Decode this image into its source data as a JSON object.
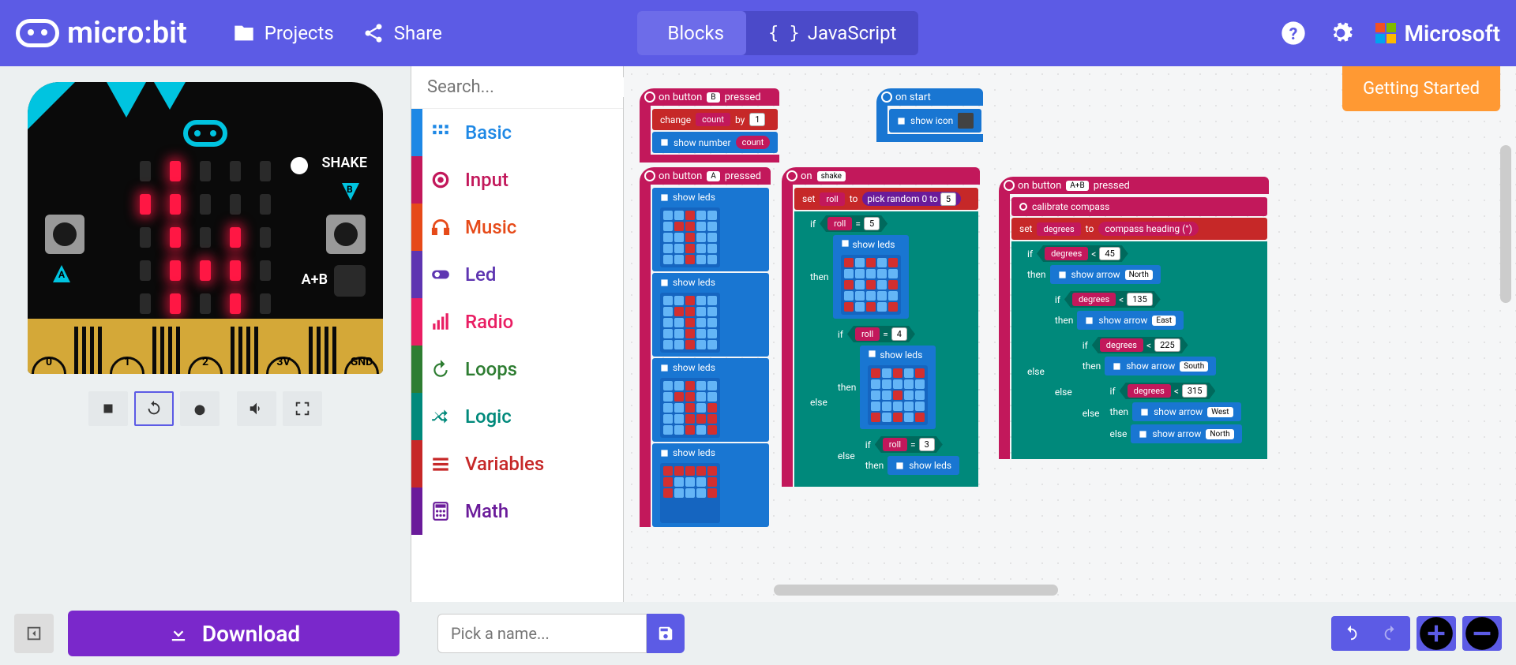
{
  "header": {
    "logo_text": "micro:bit",
    "projects": "Projects",
    "share": "Share",
    "tabs": {
      "blocks": "Blocks",
      "javascript": "JavaScript"
    },
    "microsoft": "Microsoft"
  },
  "simulator": {
    "shake": "SHAKE",
    "ab_label": "A+B",
    "pins": [
      "0",
      "1",
      "2",
      "3V",
      "GND"
    ]
  },
  "search": {
    "placeholder": "Search..."
  },
  "categories": [
    {
      "name": "Basic",
      "color": "#1e88e5",
      "icon": "grid"
    },
    {
      "name": "Input",
      "color": "#c2185b",
      "icon": "target"
    },
    {
      "name": "Music",
      "color": "#e64a19",
      "icon": "headphones"
    },
    {
      "name": "Led",
      "color": "#5e35b1",
      "icon": "toggle"
    },
    {
      "name": "Radio",
      "color": "#e91e63",
      "icon": "bars"
    },
    {
      "name": "Loops",
      "color": "#2e7d32",
      "icon": "redo"
    },
    {
      "name": "Logic",
      "color": "#00897b",
      "icon": "shuffle"
    },
    {
      "name": "Variables",
      "color": "#c62828",
      "icon": "menu"
    },
    {
      "name": "Math",
      "color": "#6a1b9a",
      "icon": "calc"
    }
  ],
  "workspace": {
    "getting_started": "Getting Started",
    "blocks": {
      "onB": {
        "header": "on button",
        "btn": "B",
        "suffix": "pressed",
        "change": "change",
        "var": "count",
        "by": "by",
        "val": "1",
        "shownum": "show number",
        "showvar": "count"
      },
      "onStart": {
        "header": "on start",
        "showicon": "show icon"
      },
      "onA": {
        "header": "on button",
        "btn": "A",
        "suffix": "pressed",
        "showleds": "show leds"
      },
      "onShake": {
        "header": "on",
        "event": "shake",
        "set": "set",
        "var": "roll",
        "to": "to",
        "pick": "pick random 0 to",
        "max": "5",
        "if": "if",
        "then": "then",
        "else": "else",
        "showleds": "show leds",
        "roll": "roll",
        "eq": "=",
        "v5": "5",
        "v4": "4",
        "v3": "3"
      },
      "onAB": {
        "header": "on button",
        "btn": "A+B",
        "suffix": "pressed",
        "calibrate": "calibrate compass",
        "set": "set",
        "var": "degrees",
        "to": "to",
        "compass": "compass heading (°)",
        "if": "if",
        "then": "then",
        "else": "else",
        "degrees": "degrees",
        "lt": "<",
        "v45": "45",
        "v135": "135",
        "v225": "225",
        "v315": "315",
        "showarrow": "show arrow",
        "north": "North",
        "east": "East",
        "south": "South",
        "west": "West"
      }
    }
  },
  "footer": {
    "download": "Download",
    "name_placeholder": "Pick a name..."
  }
}
